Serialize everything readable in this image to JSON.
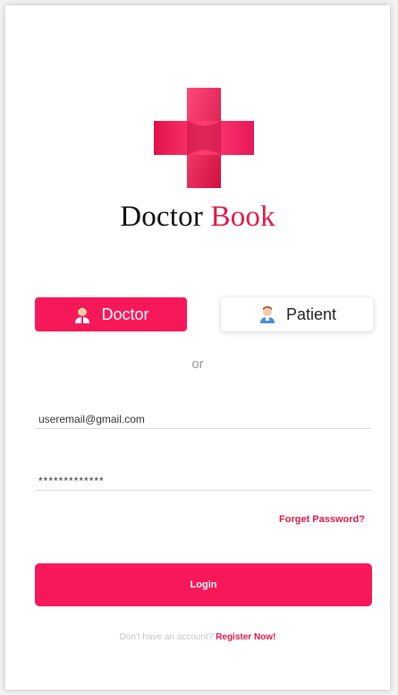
{
  "brand": {
    "name_part1": "Doctor",
    "name_part2": "Book"
  },
  "roles": {
    "doctor_label": "Doctor",
    "patient_label": "Patient",
    "doctor_icon": "doctor-avatar-icon",
    "patient_icon": "patient-avatar-icon"
  },
  "separator": "or",
  "form": {
    "email_value": "useremail@gmail.com",
    "password_value": "*************",
    "forget_password": "Forget Password?",
    "login_label": "Login"
  },
  "footer": {
    "question": "Don't have an account?",
    "register_label": "Register Now!"
  },
  "colors": {
    "accent": "#f7185a",
    "brand_red": "#e0194a"
  }
}
